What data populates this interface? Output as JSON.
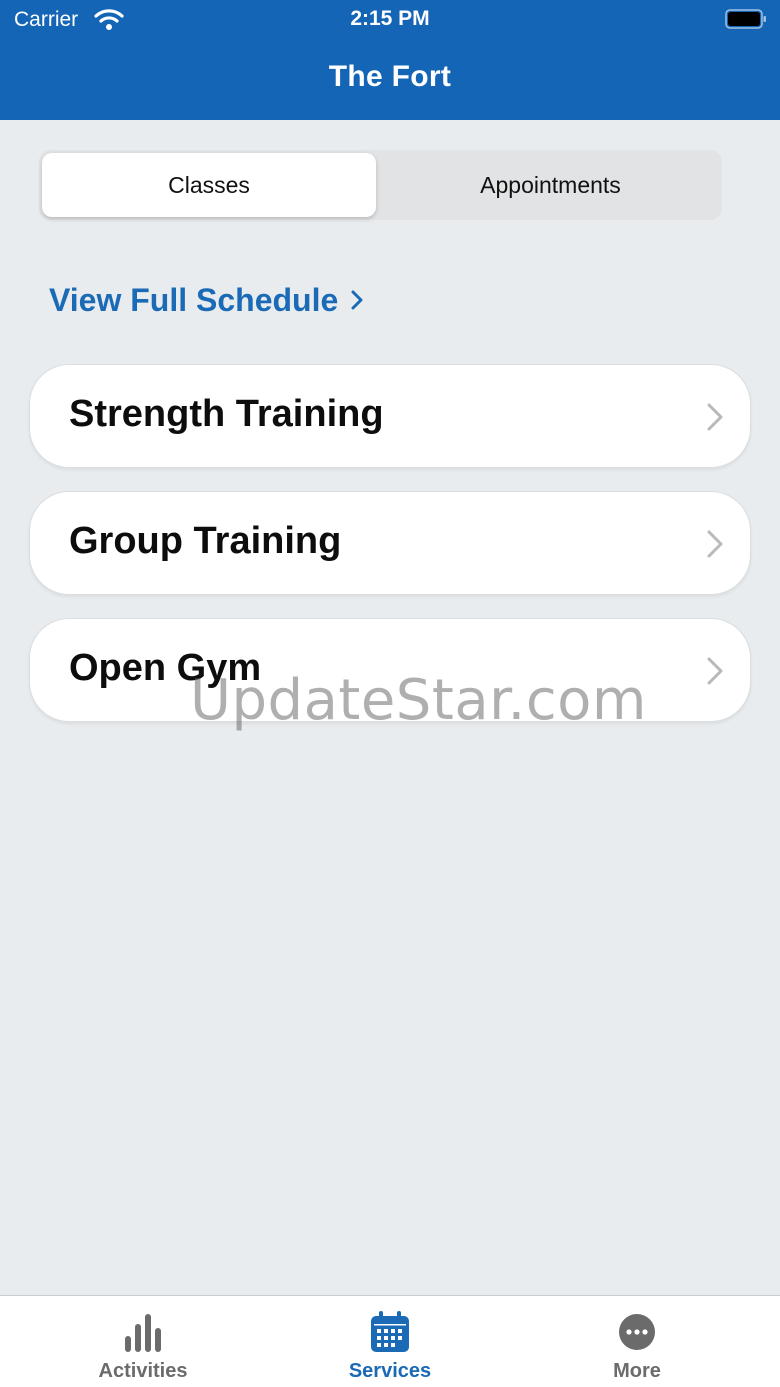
{
  "status_bar": {
    "carrier": "Carrier",
    "time": "2:15 PM"
  },
  "header": {
    "title": "The Fort"
  },
  "segments": {
    "classes": "Classes",
    "appointments": "Appointments"
  },
  "view_schedule": {
    "label": "View Full Schedule"
  },
  "items": [
    {
      "label": "Strength Training"
    },
    {
      "label": "Group Training"
    },
    {
      "label": "Open Gym"
    }
  ],
  "watermark": "UpdateStar.com",
  "tabbar": {
    "tabs": [
      {
        "label": "Activities",
        "icon": "bar-chart-icon"
      },
      {
        "label": "Services",
        "icon": "calendar-icon"
      },
      {
        "label": "More",
        "icon": "more-icon"
      }
    ],
    "active": "Services"
  },
  "colors": {
    "primary": "#1565b6",
    "link": "#1a6ab6",
    "background": "#e8ecee"
  }
}
